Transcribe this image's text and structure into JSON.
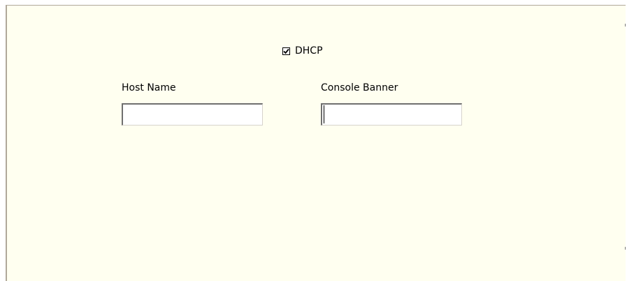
{
  "form": {
    "dhcp": {
      "label": "DHCP",
      "checked": true
    },
    "host_name": {
      "label": "Host Name",
      "value": ""
    },
    "console_banner": {
      "label": "Console Banner",
      "value": ""
    }
  },
  "icons": {
    "checkbox_mark": "check-icon"
  },
  "colors": {
    "panel_background": "#fffff0",
    "panel_border": "#b0a89a",
    "input_border_dark": "#6f6f6f",
    "input_border_light": "#d6d3cc"
  }
}
